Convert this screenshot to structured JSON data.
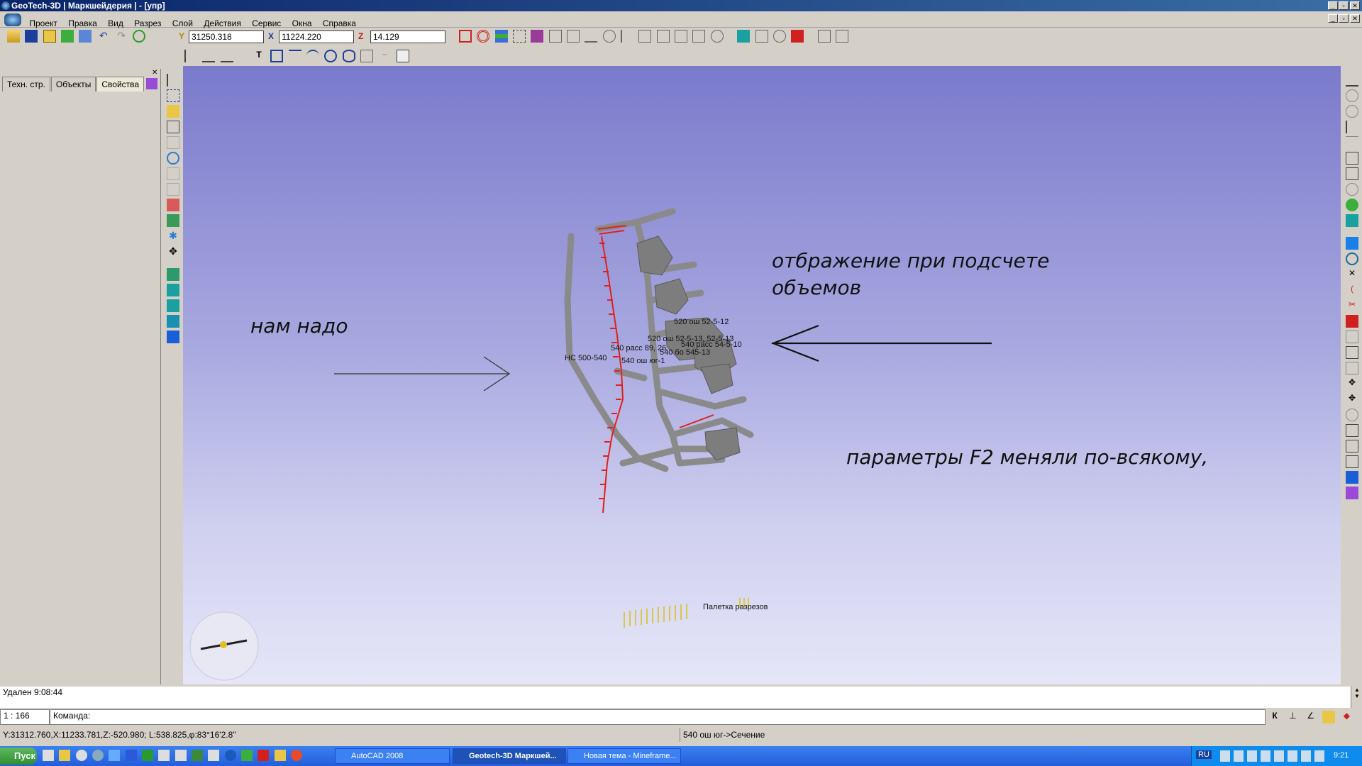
{
  "window": {
    "title": "GeoTech-3D | Маркшейдерия | - [упр]"
  },
  "menu": [
    "Проект",
    "Правка",
    "Вид",
    "Разрез",
    "Слой",
    "Действия",
    "Сервис",
    "Окна",
    "Справка"
  ],
  "coords": {
    "y_label": "Y",
    "y_value": "31250.318",
    "x_label": "X",
    "x_value": "11224.220",
    "z_label": "Z",
    "z_value": "14.129"
  },
  "panel_tabs": [
    "Техн. стр.",
    "Объекты",
    "Свойства"
  ],
  "annotations": {
    "need": "нам надо",
    "display_line1": "отбражение при подсчете",
    "display_line2": "объемов",
    "params": "параметры F2 меняли по-всякому,"
  },
  "model_labels": {
    "ns": "НС 500-540",
    "l520_top": "520 ош 52-5-12",
    "l520_mid": "520 ош 52-5-13, 52-5-13",
    "l540_rass": "540 расс 89, 26",
    "l540_right": "540 расс 54-5-10",
    "l540_bo": "540 бо 545-13",
    "l540_osh": "540 ош юг-1",
    "palette": "Палетка разрезов"
  },
  "log": {
    "line": "Удален 9:08:44"
  },
  "command": {
    "scale": "1 : 166",
    "prompt": "Команда:"
  },
  "status": {
    "coords": "Y:31312.760,X:11233.781,Z:-520.980; L:538.825,φ:83°16'2.8\"",
    "hint": "540 ош юг->Сечение"
  },
  "taskbar": {
    "start": "Пуск",
    "tasks": [
      "AutoCAD 2008",
      "Geotech-3D Маркшей...",
      "Новая тема - Mineframe..."
    ],
    "lang": "RU",
    "time": "9:21"
  },
  "colors": {
    "accent_red": "#e0201c",
    "model_gray": "#8a8a8a",
    "viewport_top": "#7a7acc"
  }
}
